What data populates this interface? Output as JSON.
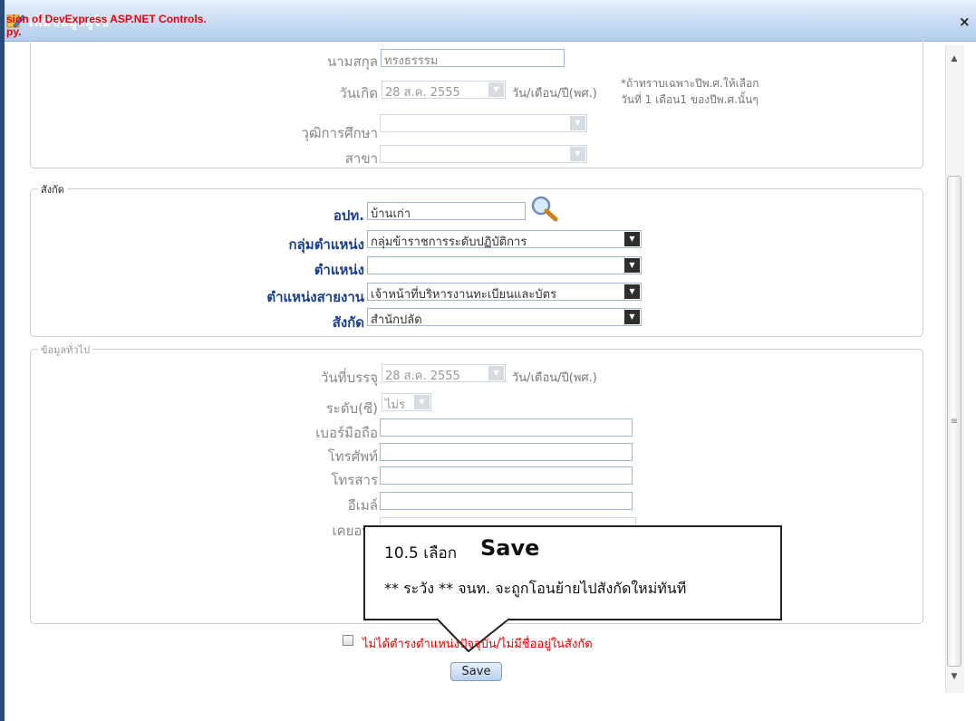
{
  "window": {
    "title": "เพิ่มข้อมูลผู้ใช้",
    "trial_text": "sion of DevExpress ASP.NET Controls.\npy.",
    "close_label": "×"
  },
  "personal": {
    "surname_label": "นามสกุล",
    "surname_value": "ทรงธรรรม",
    "birth_label": "วันเกิด",
    "birth_value": "28 ส.ค. 2555",
    "birth_format": "วัน/เดือน/ปี(พศ.)",
    "birth_hint_line1": "*ถ้าทราบเฉพาะปีพ.ศ.ให้เลือก",
    "birth_hint_line2": "วันที่ 1 เดือน1 ของปีพ.ศ.นั้นๆ",
    "education_label": "วุฒิการศึกษา",
    "branch_label": "สาขา"
  },
  "affiliation": {
    "legend": "สังกัด",
    "opt_label": "อปท.",
    "opt_value": "บ้านเก่า",
    "position_group_label": "กลุ่มตำแหน่ง",
    "position_group_value": "กลุ่มข้าราชการระดับปฏิบัติการ",
    "position_label": "ตำแหน่ง",
    "position_value": "",
    "line_position_label": "ตำแหน่งสายงาน",
    "line_position_value": "เจ้าหน้าที่บริหารงานทะเบียนและบัตร",
    "department_label": "สังกัด",
    "department_value": "สำนักปลัด"
  },
  "general": {
    "legend": "ข้อมูลทั่วไป",
    "start_date_label": "วันที่บรรจุ",
    "start_date_value": "28 ส.ค. 2555",
    "start_date_format": "วัน/เดือน/ปี(พศ.)",
    "level_label": "ระดับ(ซี)",
    "level_value": "ไม่ร",
    "mobile_label": "เบอร์มือถือ",
    "phone_label": "โทรศัพท์",
    "fax_label": "โทรสาร",
    "email_label": "อีเมล์",
    "previous_label": "เคยอบร"
  },
  "callout": {
    "step": "10.5 เลือก",
    "action": "Save",
    "warning": "** ระวัง ** จนท. จะถูกโอนย้ายไปสังกัดใหม่ทันที"
  },
  "footer": {
    "checkbox_label": "ไม่ได้ดำรงตำแหน่งปัจจุบัน/ไม่มีชื่ออยู่ในสังกัด",
    "save_label": "Save"
  },
  "colors": {
    "label_blue": "#1b3f8f",
    "trial_red": "#e8000b",
    "titlebar": "#c7dbf3"
  }
}
